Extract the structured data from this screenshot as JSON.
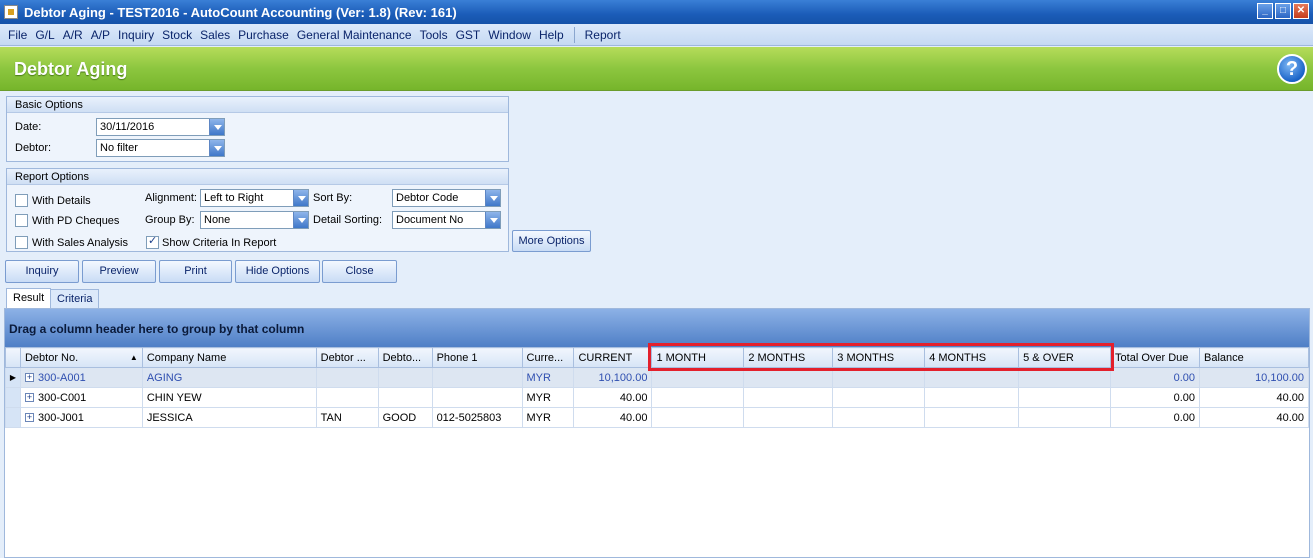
{
  "window": {
    "title": "Debtor Aging - TEST2016 - AutoCount Accounting (Ver: 1.8) (Rev: 161)",
    "min_label": "_",
    "max_label": "□",
    "close_label": "✕"
  },
  "menu": {
    "items": [
      "File",
      "G/L",
      "A/R",
      "A/P",
      "Inquiry",
      "Stock",
      "Sales",
      "Purchase",
      "General Maintenance",
      "Tools",
      "GST",
      "Window",
      "Help"
    ],
    "extra": "Report"
  },
  "banner": {
    "title": "Debtor Aging",
    "help_label": "?"
  },
  "basic_options": {
    "header": "Basic Options",
    "date_label": "Date:",
    "date_value": "30/11/2016",
    "debtor_label": "Debtor:",
    "debtor_value": "No filter"
  },
  "report_options": {
    "header": "Report Options",
    "with_details": "With Details",
    "with_pd_cheques": "With PD Cheques",
    "with_sales_analysis": "With Sales Analysis",
    "alignment_label": "Alignment:",
    "alignment_value": "Left to Right",
    "group_by_label": "Group By:",
    "group_by_value": "None",
    "show_criteria": "Show Criteria In Report",
    "sort_by_label": "Sort By:",
    "sort_by_value": "Debtor Code",
    "detail_sorting_label": "Detail Sorting:",
    "detail_sorting_value": "Document No",
    "more_options": "More Options"
  },
  "buttons": {
    "inquiry": "Inquiry",
    "preview": "Preview",
    "print": "Print",
    "hide_options": "Hide Options",
    "close": "Close"
  },
  "tabs": {
    "result": "Result",
    "criteria": "Criteria"
  },
  "grid": {
    "group_hint": "Drag a column header here to group by that column",
    "columns": [
      "Debtor No.",
      "Company Name",
      "Debtor ...",
      "Debto...",
      "Phone 1",
      "Curre...",
      "CURRENT",
      "1 MONTH",
      "2 MONTHS",
      "3 MONTHS",
      "4 MONTHS",
      "5 & OVER",
      "Total Over Due",
      "Balance"
    ],
    "rows": [
      {
        "debtor_no": "300-A001",
        "company": "AGING",
        "c3": "",
        "c4": "",
        "phone": "",
        "currency": "MYR",
        "current": "10,100.00",
        "m1": "",
        "m2": "",
        "m3": "",
        "m4": "",
        "m5": "",
        "total_over_due": "0.00",
        "balance": "10,100.00"
      },
      {
        "debtor_no": "300-C001",
        "company": "CHIN YEW",
        "c3": "",
        "c4": "",
        "phone": "",
        "currency": "MYR",
        "current": "40.00",
        "m1": "",
        "m2": "",
        "m3": "",
        "m4": "",
        "m5": "",
        "total_over_due": "0.00",
        "balance": "40.00"
      },
      {
        "debtor_no": "300-J001",
        "company": "JESSICA",
        "c3": "TAN",
        "c4": "GOOD",
        "phone": "012-5025803",
        "currency": "MYR",
        "current": "40.00",
        "m1": "",
        "m2": "",
        "m3": "",
        "m4": "",
        "m5": "",
        "total_over_due": "0.00",
        "balance": "40.00"
      }
    ]
  },
  "colors": {
    "highlight": "#e3202c",
    "banner": "#8cc63f"
  }
}
